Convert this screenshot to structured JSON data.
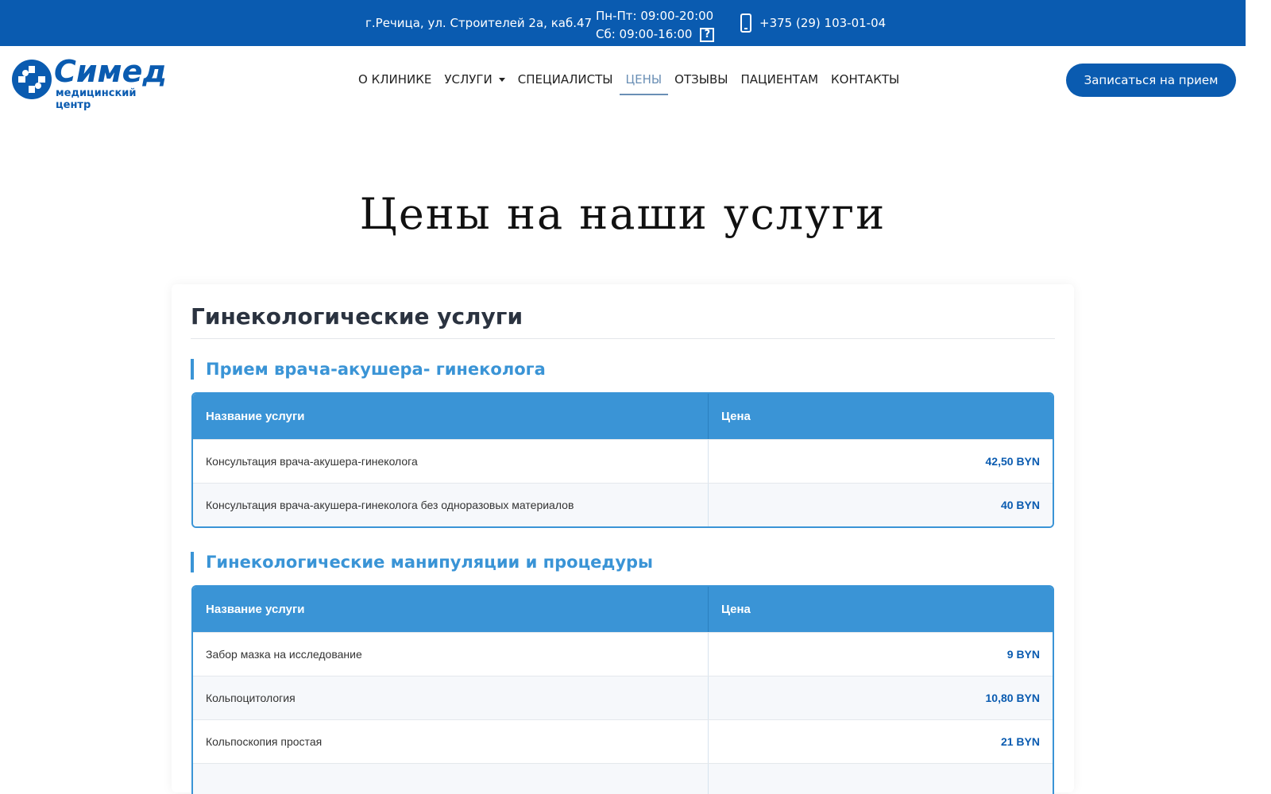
{
  "topbar": {
    "address": "г.Речица, ул. Строителей 2а, каб.47",
    "hours_weekdays": "Пн-Пт: 09:00-20:00",
    "hours_saturday": "Сб: 09:00-16:00",
    "phone": "+375 (29) 103-01-04"
  },
  "logo": {
    "name": "Симед",
    "subtitle": "медицинский центр",
    "color": "#0a5bb0"
  },
  "nav": {
    "items": [
      {
        "label": "О КЛИНИКЕ"
      },
      {
        "label": "УСЛУГИ"
      },
      {
        "label": "СПЕЦИАЛИСТЫ"
      },
      {
        "label": "ЦЕНЫ"
      },
      {
        "label": "ОТЗЫВЫ"
      },
      {
        "label": "ПАЦИЕНТАМ"
      },
      {
        "label": "КОНТАКТЫ"
      }
    ],
    "active": "ЦЕНЫ"
  },
  "cta": {
    "label": "Записаться на прием"
  },
  "page": {
    "title": "Цены на наши услуги"
  },
  "section": {
    "title": "Гинекологические услуги",
    "groups": [
      {
        "title": "Прием врача-акушера- гинеколога",
        "header": {
          "name": "Название услуги",
          "price": "Цена"
        },
        "rows": [
          {
            "name": "Консультация врача-акушера-гинеколога",
            "price": "42,50 BYN"
          },
          {
            "name": "Консультация врача-акушера-гинеколога без одноразовых материалов",
            "price": "40 BYN"
          }
        ]
      },
      {
        "title": "Гинекологические манипуляции и процедуры",
        "header": {
          "name": "Название услуги",
          "price": "Цена"
        },
        "rows": [
          {
            "name": "Забор мазка на исследование",
            "price": "9 BYN"
          },
          {
            "name": "Кольпоцитология",
            "price": "10,80 BYN"
          },
          {
            "name": "Кольпоскопия простая",
            "price": "21 BYN"
          }
        ]
      }
    ]
  },
  "colors": {
    "brand": "#0a5bb0",
    "accent": "#3a94d6",
    "nav_active": "#6a8fb5"
  }
}
